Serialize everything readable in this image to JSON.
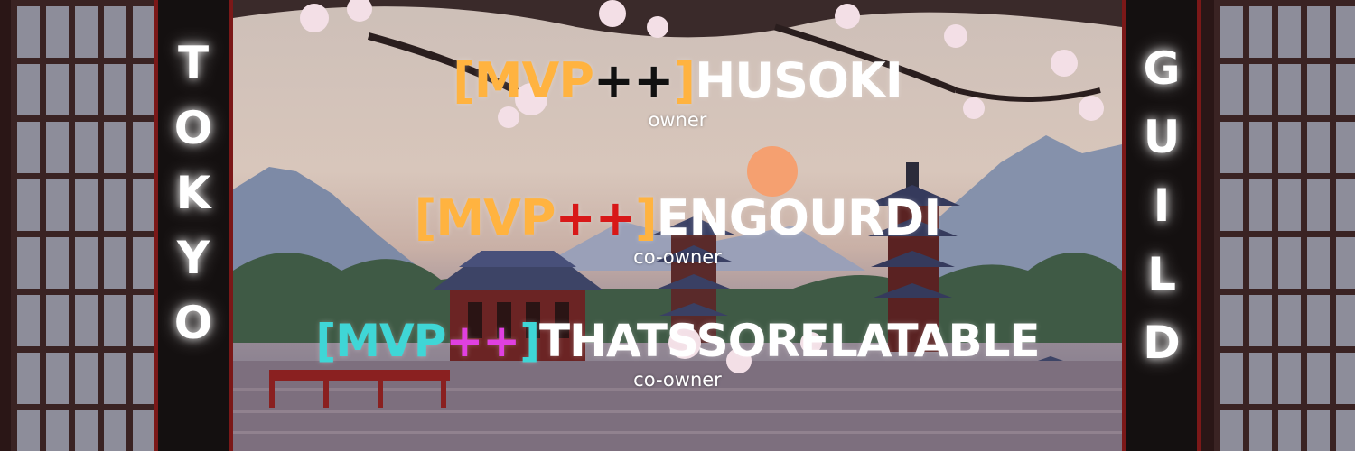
{
  "banner": {
    "left_word": [
      "T",
      "O",
      "K",
      "Y",
      "O"
    ],
    "right_word": [
      "G",
      "U",
      "I",
      "L",
      "D"
    ],
    "members": [
      {
        "rank_open": "[",
        "rank_label": "MVP",
        "rank_plus": "++",
        "rank_close": "]",
        "name": "HUSOKI",
        "role": "owner",
        "rank_color": "#ffb340",
        "plus_color": "#111111"
      },
      {
        "rank_open": "[",
        "rank_label": "MVP",
        "rank_plus": "++",
        "rank_close": "]",
        "name": "ENGOURDI",
        "role": "co-owner",
        "rank_color": "#ffb340",
        "plus_color": "#d81818"
      },
      {
        "rank_open": "[",
        "rank_label": "MVP",
        "rank_plus": "++",
        "rank_close": "]",
        "name": "THATSSORELATABLE",
        "role": "co-owner",
        "rank_color": "#3fd6d6",
        "plus_color": "#e040e0"
      }
    ]
  },
  "colors": {
    "pillar_red": "#8b1c1c",
    "glow_white": "#ffffff",
    "sun": "#f5a070"
  },
  "icons": {
    "scene": "pixel-art-japanese-landscape",
    "sun": "sun-icon",
    "pagoda": "pagoda-icon",
    "cherry_blossom": "cherry-blossom-icon"
  }
}
